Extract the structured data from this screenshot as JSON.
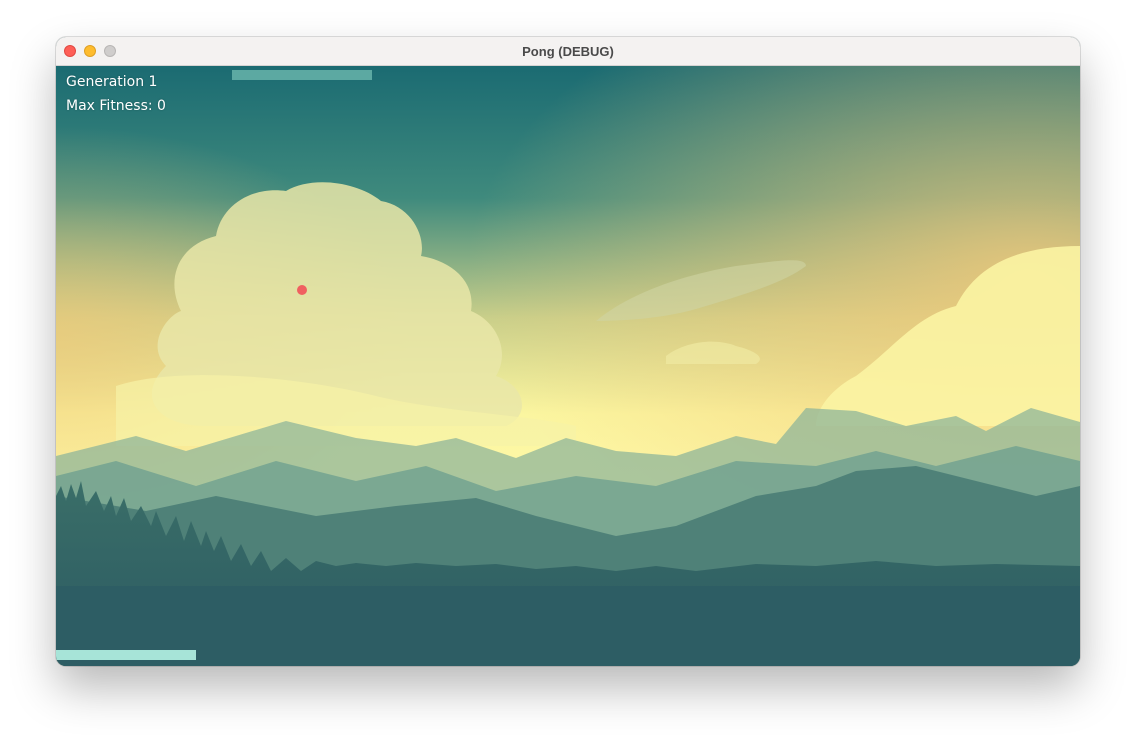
{
  "window": {
    "title": "Pong (DEBUG)"
  },
  "hud": {
    "generation": "Generation 1",
    "max_fitness": "Max Fitness: 0"
  },
  "colors": {
    "ball": "#f06060",
    "top_paddle": "#5ca9a2",
    "bottom_paddle": "#a7e4d8"
  },
  "icons": {
    "close": "close-icon",
    "minimize": "minimize-icon",
    "zoom": "zoom-icon"
  }
}
